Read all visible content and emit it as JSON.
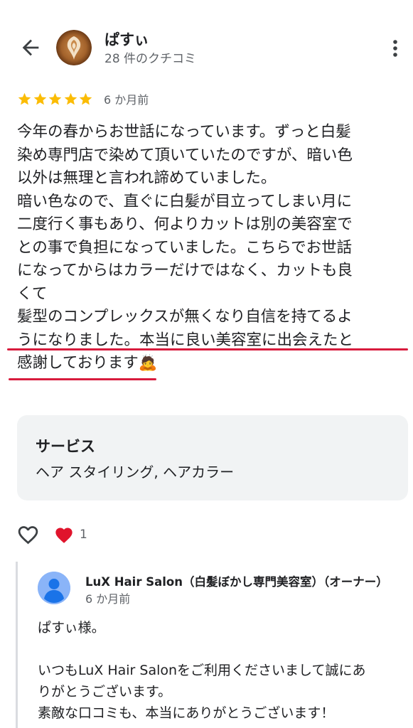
{
  "reviewer": {
    "name": "ぱすぃ",
    "review_count": "28 件のクチコミ"
  },
  "review": {
    "rating": 5,
    "date": "6 か月前",
    "text": "今年の春からお世話になっています。ずっと白髪\n染め専門店で染めて頂いていたのですが、暗い色\n以外は無理と言われ諦めていました。\n暗い色なので、直ぐに白髪が目立ってしまい月に\n二度行く事もあり、何よりカットは別の美容室で\nとの事で負担になっていました。こちらでお世話\nになってからはカラーだけではなく、カットも良\nくて\n髪型のコンプレックスが無くなり自信を持てるよ\nうになりました。本当に良い美容室に出会えたと\n感謝しております🙇"
  },
  "services": {
    "label": "サービス",
    "value": "ヘア スタイリング, ヘアカラー"
  },
  "reactions": {
    "count": "1"
  },
  "owner_reply": {
    "name": "LuX Hair Salon（白髪ぼかし専門美容室）（オーナー）",
    "date": "6 か月前",
    "text": "ぱすぃ様。\n\nいつもLuX Hair Salonをご利用くださいまして誠にあ\nりがとうございます。\n素敵な口コミも、本当にありがとうございます！"
  },
  "colors": {
    "star": "#fbbc04",
    "underline": "#d81b3d",
    "card_bg": "#f1f3f4",
    "secondary_text": "#5f6368"
  },
  "icons": {
    "back": "arrow-back-icon",
    "more": "more-vert-icon",
    "like": "heart-outline-icon",
    "reaction": "red-heart-icon",
    "owner_avatar": "default-person-icon"
  }
}
